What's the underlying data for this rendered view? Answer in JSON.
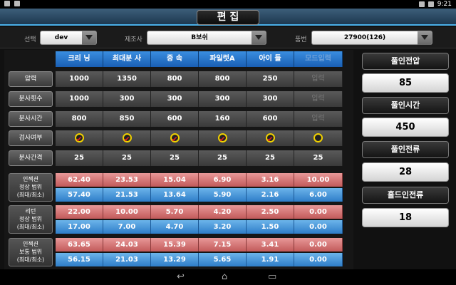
{
  "status": {
    "time": "9:21"
  },
  "title": "편 집",
  "filters": {
    "select_label": "선택",
    "select_value": "dev",
    "maker_label": "제조사",
    "maker_value": "B보쉬",
    "part_label": "품번",
    "part_value": "27900(126)"
  },
  "columns": [
    "크리 닝",
    "최대분 사",
    "중 속",
    "파일럿A",
    "아이 들",
    "모드입력"
  ],
  "rows": {
    "pressure": {
      "label": "압력",
      "values": [
        "1000",
        "1350",
        "800",
        "800",
        "250",
        "입력"
      ]
    },
    "count": {
      "label": "분사횟수",
      "values": [
        "1000",
        "300",
        "300",
        "300",
        "300",
        "입력"
      ]
    },
    "time": {
      "label": "분사시간",
      "values": [
        "800",
        "850",
        "600",
        "160",
        "600",
        "입력"
      ]
    },
    "check": {
      "label": "검사여부",
      "values": [
        true,
        true,
        true,
        true,
        true,
        false
      ]
    },
    "interval": {
      "label": "분사간격",
      "values": [
        "25",
        "25",
        "25",
        "25",
        "25",
        "25"
      ]
    }
  },
  "ranges": [
    {
      "label": [
        "인젝션",
        "정상 범위",
        "(최대/최소)"
      ],
      "max": [
        "62.40",
        "23.53",
        "15.04",
        "6.90",
        "3.16",
        "10.00"
      ],
      "min": [
        "57.40",
        "21.53",
        "13.64",
        "5.90",
        "2.16",
        "6.00"
      ]
    },
    {
      "label": [
        "리턴",
        "정상 범위",
        "(최대/최소)"
      ],
      "max": [
        "22.00",
        "10.00",
        "5.70",
        "4.20",
        "2.50",
        "0.00"
      ],
      "min": [
        "17.00",
        "7.00",
        "4.70",
        "3.20",
        "1.50",
        "0.00"
      ]
    },
    {
      "label": [
        "인젝션",
        "보통 범위",
        "(최대/최소)"
      ],
      "max": [
        "63.65",
        "24.03",
        "15.39",
        "7.15",
        "3.41",
        "0.00"
      ],
      "min": [
        "56.15",
        "21.03",
        "13.29",
        "5.65",
        "1.91",
        "0.00"
      ]
    }
  ],
  "right": [
    {
      "label": "풀인전압",
      "value": "85"
    },
    {
      "label": "풀인시간",
      "value": "450"
    },
    {
      "label": "풀인전류",
      "value": "28"
    },
    {
      "label": "홀드인전류",
      "value": "18"
    }
  ]
}
